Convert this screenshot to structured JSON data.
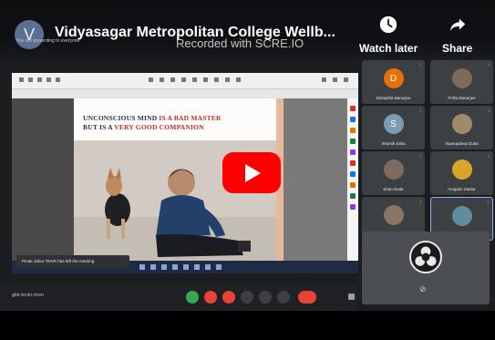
{
  "header": {
    "channel_initial": "V",
    "title": "Vidyasagar Metropolitan College Wellb...",
    "watermark": "Recorded with SCRE.IO",
    "meet_banner": "You are presenting to everyone",
    "watch_later_label": "Watch later",
    "share_label": "Share"
  },
  "slide": {
    "line1_before": "UNCONSCIOUS MIND ",
    "line1_highlight": "IS A BAD MASTER",
    "line2_before": "BUT IS A ",
    "line2_highlight": "VERY GOOD COMPANION"
  },
  "notification": "Pinak Jahar TENR has left the meeting",
  "participants": [
    {
      "name": "Debadrita Banerjee",
      "initial": "D",
      "color": "#e8710a"
    },
    {
      "name": "Pritha Banerjee",
      "initial": "",
      "color": "#7c6a5a"
    },
    {
      "name": "Shamik Saha",
      "initial": "S",
      "color": "#7b9bb3"
    },
    {
      "name": "Swarupdeep Dutta",
      "initial": "",
      "color": "#a08a6c"
    },
    {
      "name": "Kiran Dutta",
      "initial": "",
      "color": "#7d6b60"
    },
    {
      "name": "Anupam Sarkar",
      "initial": "",
      "color": "#d8a52b"
    },
    {
      "name": "Mainul Pramanik",
      "initial": "",
      "color": "#8a7564"
    },
    {
      "name": "Devasmita Kulai Dutta G...",
      "initial": "",
      "color": "#5f8c9e"
    }
  ],
  "meeting_code": "gkk-bcdo-mon",
  "colors": {
    "youtube_red": "#ff0000",
    "meet_red": "#ea4335",
    "meet_green": "#34a853",
    "slide_navy": "#23344f",
    "slide_red": "#b3312a"
  },
  "icons": {
    "watch_later": "clock-icon",
    "share": "share-arrow-icon",
    "play": "play-icon",
    "camera_off": "camera-off-icon"
  }
}
